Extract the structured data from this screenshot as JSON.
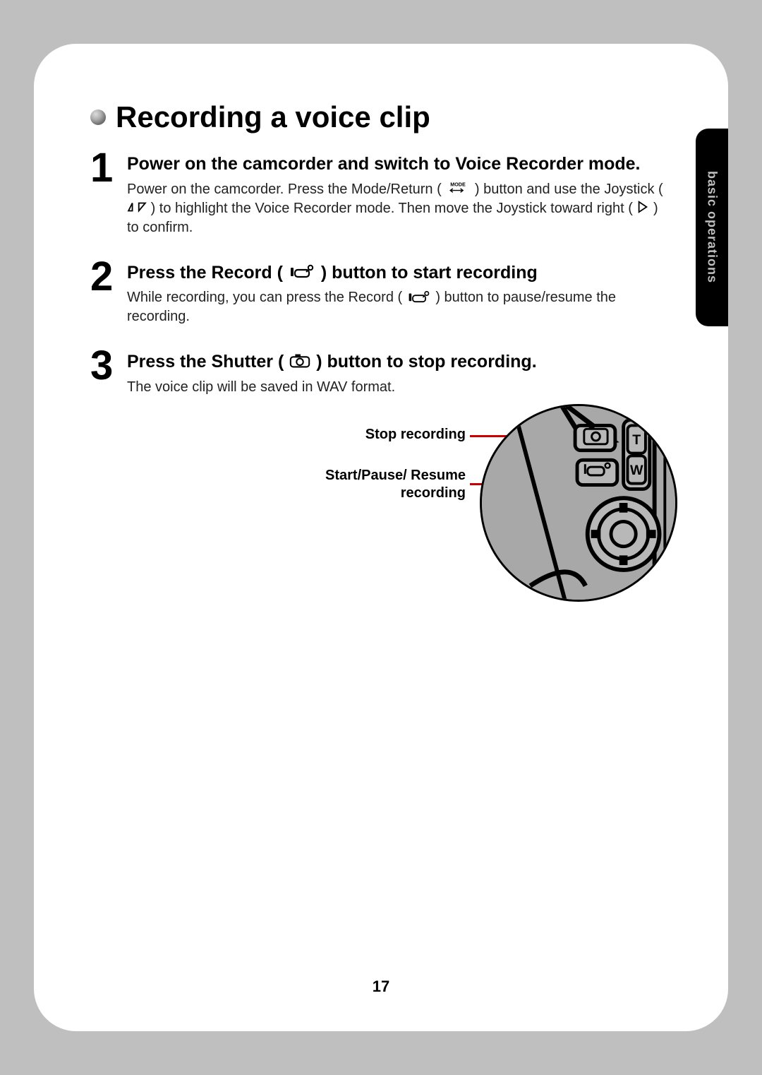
{
  "sideTab": "basic operations",
  "title": "Recording a voice clip",
  "steps": [
    {
      "num": "1",
      "head": "Power on the camcorder and switch to Voice Recorder mode.",
      "text_a": "Power on the camcorder. Press the Mode/Return (",
      "text_b": ") button and use the Joystick (",
      "text_c": ") to highlight the Voice Recorder mode. Then move the Joystick toward right (",
      "text_d": ") to confirm."
    },
    {
      "num": "2",
      "head_a": "Press the Record (",
      "head_b": ") button to start recording",
      "text_a": "While recording, you can press the Record (",
      "text_b": ") button to pause/resume the recording."
    },
    {
      "num": "3",
      "head_a": "Press the Shutter (",
      "head_b": ") button to stop recording.",
      "text": "The voice clip will be saved in WAV format."
    }
  ],
  "diagram": {
    "label_stop": "Stop recording",
    "label_start": "Start/Pause/ Resume recording",
    "device_letters": {
      "t": "T",
      "w": "W"
    }
  },
  "pageNumber": "17"
}
